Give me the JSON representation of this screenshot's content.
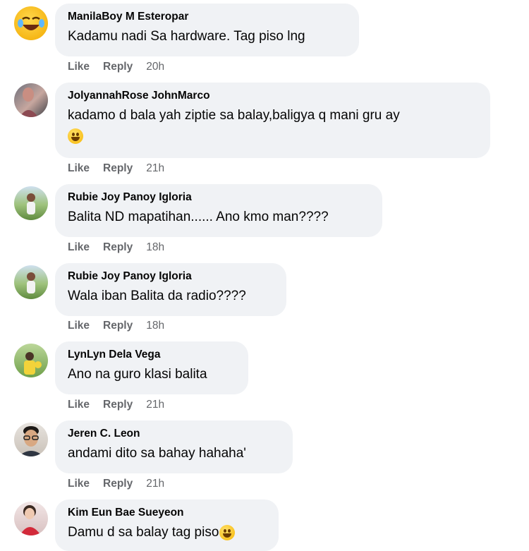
{
  "comments": [
    {
      "author": "ManilaBoy M Esteropar",
      "text": "Kadamu nadi Sa hardware. Tag piso lng",
      "like": "Like",
      "reply": "Reply",
      "time": "20h",
      "avatar": "laughing-emoji-avatar",
      "emoji": ""
    },
    {
      "author": "JolyannahRose JohnMarco",
      "text": "kadamo d bala yah ziptie sa balay,baligya q mani gru ay",
      "like": "Like",
      "reply": "Reply",
      "time": "21h",
      "avatar": "profile-photo",
      "emoji": "grinning-face-emoji"
    },
    {
      "author": "Rubie Joy Panoy Igloria",
      "text": "Balita ND mapatihan...... Ano kmo man????",
      "like": "Like",
      "reply": "Reply",
      "time": "18h",
      "avatar": "profile-photo",
      "emoji": ""
    },
    {
      "author": "Rubie Joy Panoy Igloria",
      "text": "Wala iban Balita da radio????",
      "like": "Like",
      "reply": "Reply",
      "time": "18h",
      "avatar": "profile-photo",
      "emoji": ""
    },
    {
      "author": "LynLyn Dela Vega",
      "text": "Ano na guro klasi balita",
      "like": "Like",
      "reply": "Reply",
      "time": "21h",
      "avatar": "profile-photo",
      "emoji": ""
    },
    {
      "author": "Jeren C. Leon",
      "text": "andami dito sa bahay hahaha'",
      "like": "Like",
      "reply": "Reply",
      "time": "21h",
      "avatar": "profile-photo",
      "emoji": ""
    },
    {
      "author": "Kim Eun Bae Sueyeon",
      "text": "Damu d sa balay tag piso",
      "like": "Like",
      "reply": "Reply",
      "time": "",
      "avatar": "profile-photo",
      "emoji": "laughing-tears-emoji"
    }
  ],
  "colors": {
    "bubble": "#f0f2f5",
    "author": "#050505",
    "meta": "#65676b"
  }
}
